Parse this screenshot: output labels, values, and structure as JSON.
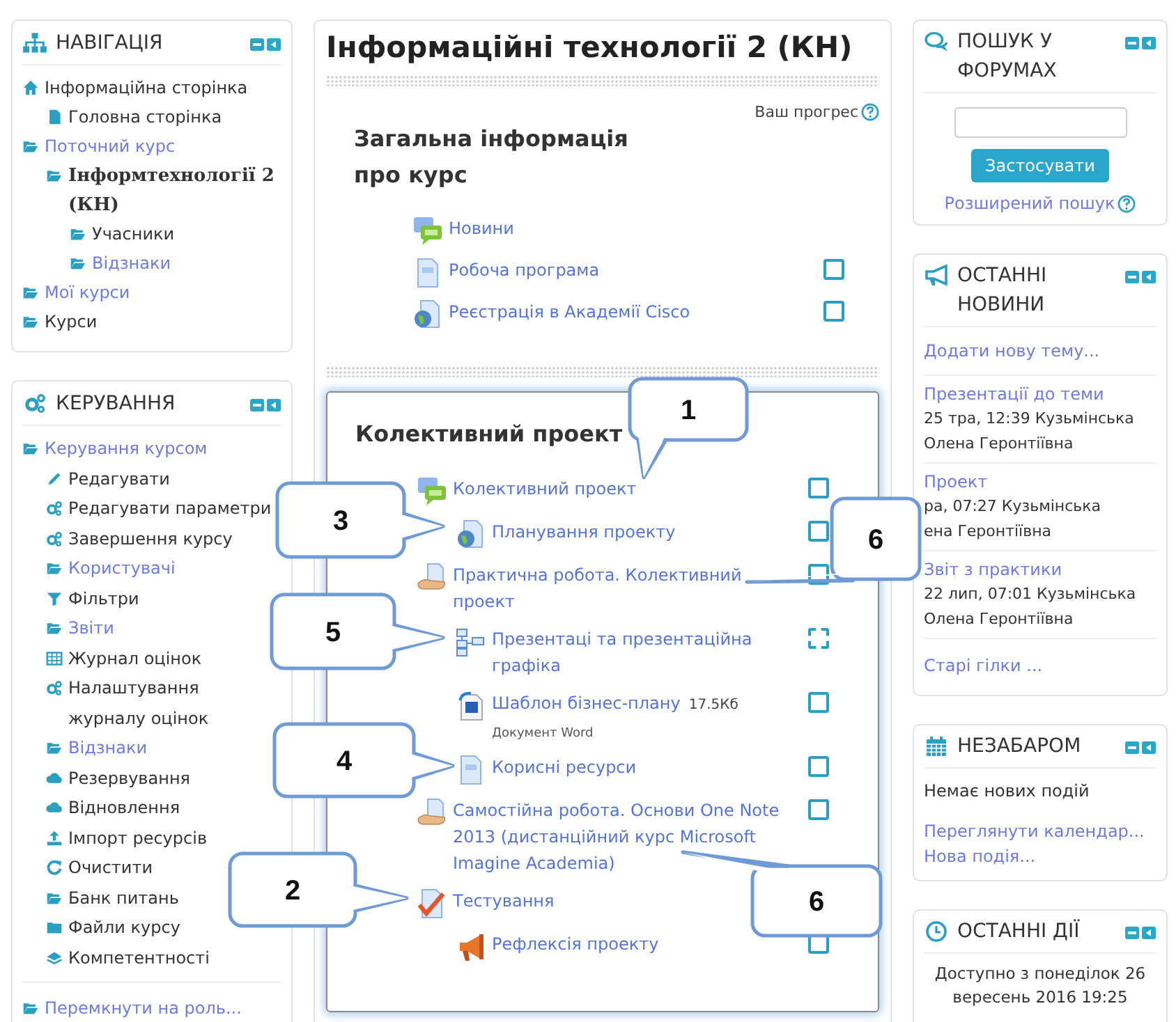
{
  "navigation": {
    "title": "НАВІГАЦІЯ",
    "items": [
      {
        "label": "Інформаційна сторінка",
        "kind": "home",
        "link": false,
        "current": false,
        "children": [
          {
            "label": "Головна сторінка",
            "kind": "page",
            "link": false,
            "current": false
          }
        ]
      },
      {
        "label": "Поточний курс",
        "kind": "folder",
        "link": true,
        "current": false,
        "children": [
          {
            "label": "Інформтехнології 2 (КН)",
            "kind": "folder",
            "link": false,
            "current": true,
            "children": [
              {
                "label": "Учасники",
                "kind": "folder",
                "link": false,
                "current": false
              },
              {
                "label": "Відзнаки",
                "kind": "folder",
                "link": true,
                "current": false
              }
            ]
          }
        ]
      },
      {
        "label": "Мої курси",
        "kind": "folder",
        "link": true,
        "current": false
      },
      {
        "label": "Курси",
        "kind": "folder",
        "link": false,
        "current": false
      }
    ]
  },
  "administration": {
    "title": "КЕРУВАННЯ",
    "items": [
      {
        "label": "Керування курсом",
        "kind": "folder",
        "link": true,
        "children": [
          {
            "label": "Редагувати",
            "kind": "edit",
            "link": false
          },
          {
            "label": "Редагувати параметри",
            "kind": "settings",
            "link": false
          },
          {
            "label": "Завершення курсу",
            "kind": "settings",
            "link": false
          },
          {
            "label": "Користувачі",
            "kind": "folder",
            "link": true
          },
          {
            "label": "Фільтри",
            "kind": "filter",
            "link": false
          },
          {
            "label": "Звіти",
            "kind": "folder",
            "link": true
          },
          {
            "label": "Журнал оцінок",
            "kind": "grades",
            "link": false
          },
          {
            "label": "Налаштування журналу оцінок",
            "kind": "settings",
            "link": false
          },
          {
            "label": "Відзнаки",
            "kind": "folder",
            "link": true
          },
          {
            "label": "Резервування",
            "kind": "backup",
            "link": false
          },
          {
            "label": "Відновлення",
            "kind": "restore",
            "link": false
          },
          {
            "label": "Імпорт ресурсів",
            "kind": "import",
            "link": false
          },
          {
            "label": "Очистити",
            "kind": "reset",
            "link": false
          },
          {
            "label": "Банк питань",
            "kind": "folder",
            "link": false
          },
          {
            "label": "Файли курсу",
            "kind": "files",
            "link": false
          },
          {
            "label": "Компетентності",
            "kind": "competencies",
            "link": false
          }
        ]
      }
    ],
    "footer_link": {
      "label": "Перемкнути на роль...",
      "kind": "folder",
      "link": true
    }
  },
  "course": {
    "title": "Інформаційні технології 2 (КН)",
    "progress_label": "Ваш прогрес",
    "sections": [
      {
        "title": "Загальна інформація про курс",
        "highlighted": false,
        "activities": [
          {
            "kind": "forum",
            "label": "Новини"
          },
          {
            "kind": "page",
            "label": "Робоча програма",
            "checkbox": {
              "kind": "manual",
              "checked": false
            }
          },
          {
            "kind": "url",
            "label": "Реєстрація в Академії Cisco",
            "checkbox": {
              "kind": "manual",
              "checked": false
            }
          }
        ]
      },
      {
        "title": "Колективний проект",
        "highlighted": true,
        "activities": [
          {
            "kind": "forum",
            "label": "Колективний проект",
            "checkbox": {
              "kind": "manual",
              "checked": false
            },
            "children": [
              {
                "kind": "url",
                "label": "Планування проекту",
                "checkbox": {
                  "kind": "manual",
                  "checked": false
                }
              }
            ]
          },
          {
            "kind": "assign",
            "label": "Практична робота. Колективний проект",
            "checkbox": {
              "kind": "manual",
              "checked": false
            },
            "children": [
              {
                "kind": "folder",
                "label": "Презентаці та презентаційна графіка",
                "checkbox": {
                  "kind": "auto",
                  "checked": false
                }
              },
              {
                "kind": "file",
                "label": "Шаблон бізнес-плану",
                "size": "17.5Кб",
                "type_label": "Документ Word",
                "checkbox": {
                  "kind": "manual",
                  "checked": false
                }
              },
              {
                "kind": "page",
                "label": "Корисні ресурси",
                "checkbox": {
                  "kind": "manual",
                  "checked": false
                }
              }
            ]
          },
          {
            "kind": "assign",
            "label": "Самостійна робота. Основи One Note 2013 (дистанційний курс Microsoft Imagine Academia)",
            "checkbox": {
              "kind": "manual",
              "checked": false
            }
          },
          {
            "kind": "quiz",
            "label": "Тестування",
            "children": [
              {
                "kind": "feedback",
                "label": "Рефлексія проекту",
                "checkbox": {
                  "kind": "manual",
                  "checked": false
                }
              }
            ]
          }
        ]
      }
    ]
  },
  "search_forums": {
    "title": "ПОШУК У ФОРУМАХ",
    "button": "Застосувати",
    "advanced_link": "Розширений пошук"
  },
  "latest_news": {
    "title": "ОСТАННІ НОВИНИ",
    "add_link": "Додати нову тему...",
    "posts": [
      {
        "title": "Презентації до теми",
        "meta": [
          "25 тра, 12:39  Кузьмінська",
          "Олена Геронтіївна"
        ]
      },
      {
        "title": "Проект",
        "meta": [
          "ра, 07:27  Кузьмінська",
          "ена Геронтіївна"
        ]
      },
      {
        "title": "Звіт з практики",
        "meta": [
          "22 лип, 07:01  Кузьмінська",
          "Олена Геронтіївна"
        ]
      }
    ],
    "older_link": "Старі гілки ..."
  },
  "upcoming": {
    "title": "НЕЗАБАРОМ",
    "empty_text": "Немає нових подій",
    "links": [
      "Переглянути календар...",
      "Нова подія..."
    ]
  },
  "recent_activity": {
    "title": "ОСТАННІ ДІЇ",
    "text": "Доступно з понеділок 26 вересень 2016 19:25"
  },
  "callouts": [
    {
      "label": "1"
    },
    {
      "label": "3"
    },
    {
      "label": "6"
    },
    {
      "label": "5"
    },
    {
      "label": "4"
    },
    {
      "label": "2"
    },
    {
      "label": "6"
    }
  ]
}
